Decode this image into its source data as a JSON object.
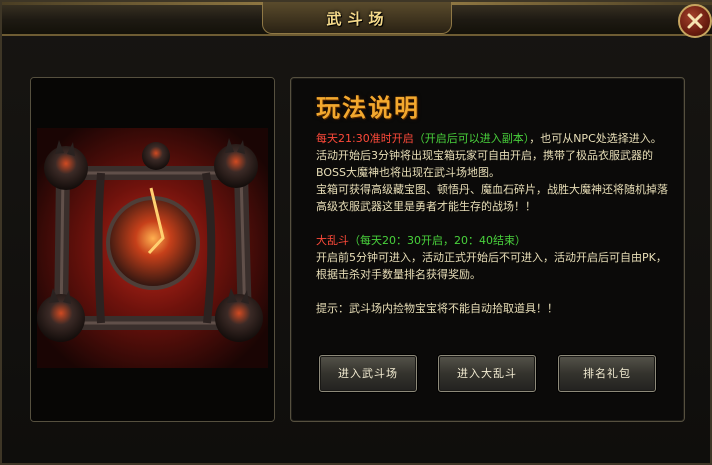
{
  "window": {
    "title": "武斗场"
  },
  "info": {
    "heading": "玩法说明",
    "para1_red": "每天21:30准时开启",
    "para1_green": "（开启后可以进入副本）",
    "para1_rest": "，也可从NPC处选择进入。活动开始后3分钟将出现宝箱玩家可自由开启，携带了极品衣服武器的BOSS大魔神也将出现在武斗场地图。",
    "para2": "宝箱可获得高级藏宝图、顿悟丹、魔血石碎片，战胜大魔神还将随机掉落高级衣服武器这里是勇者才能生存的战场！！",
    "para3_red": "大乱斗",
    "para3_green": "（每天20：30开启，20：40结束）",
    "para4": "开启前5分钟可进入，活动正式开始后不可进入，活动开启后可自由PK，根据击杀对手数量排名获得奖励。",
    "tip": "提示：武斗场内捡物宝宝将不能自动拾取道具！！"
  },
  "buttons": {
    "enter_arena": "进入武斗场",
    "enter_melee": "进入大乱斗",
    "rank_gift": "排名礼包"
  },
  "icons": {
    "close": "close-x-icon"
  }
}
